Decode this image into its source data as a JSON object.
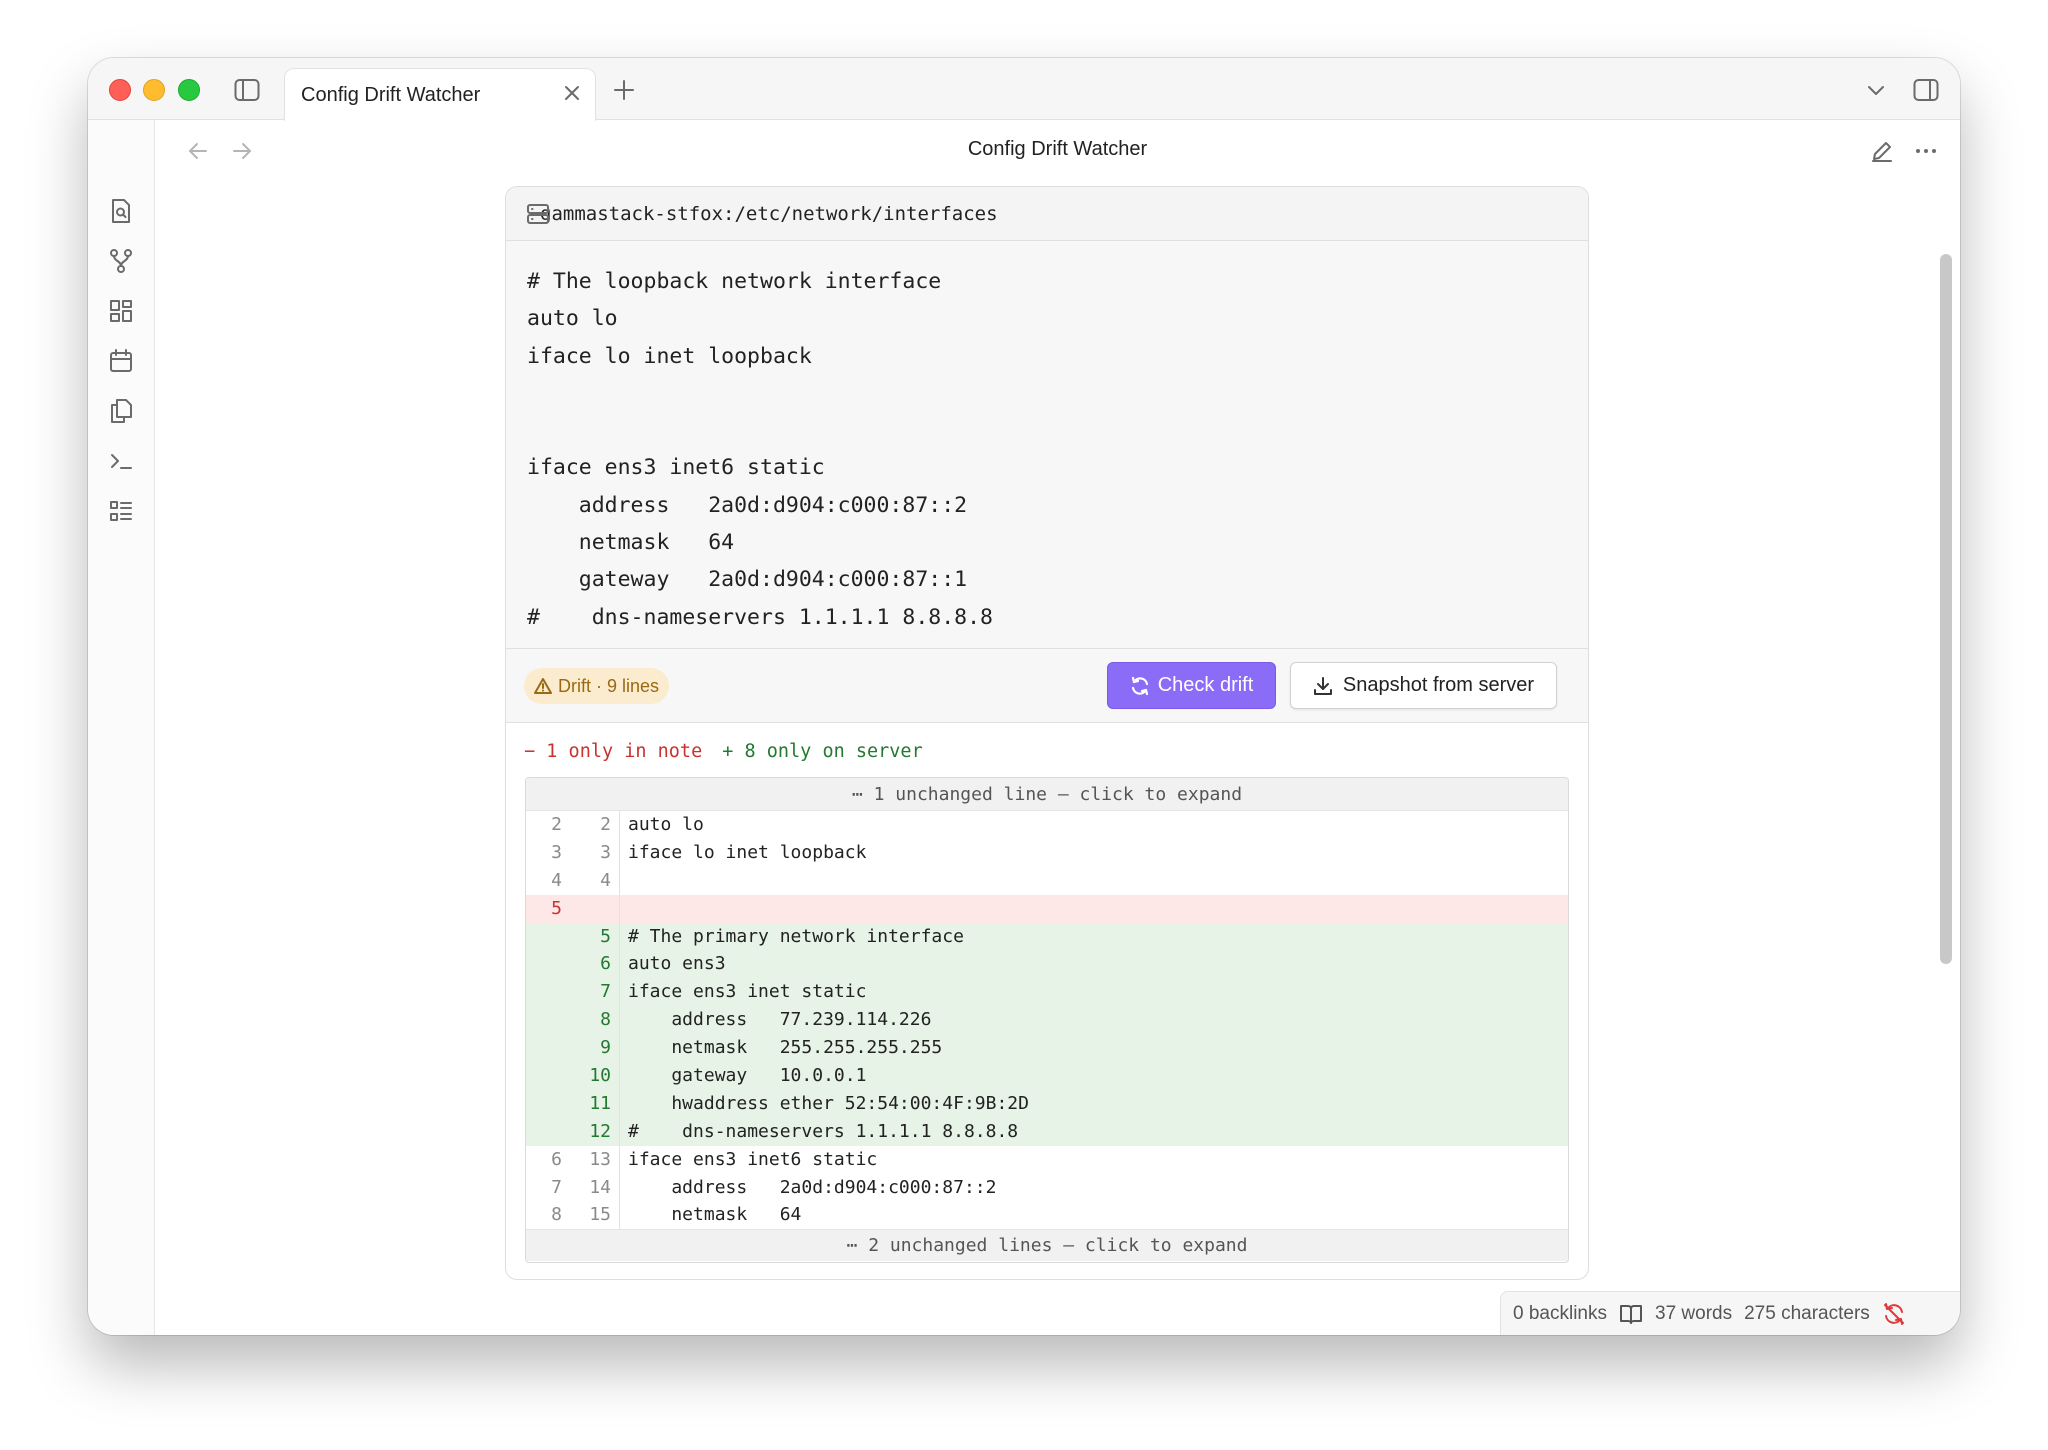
{
  "window": {
    "tab_title": "Config Drift Watcher",
    "view_title": "Config Drift Watcher"
  },
  "block": {
    "path": "gammastack-stfox:/etc/network/interfaces",
    "code_lines": [
      "# The loopback network interface",
      "auto lo",
      "iface lo inet loopback",
      "",
      "",
      "iface ens3 inet6 static",
      "    address   2a0d:d904:c000:87::2",
      "    netmask   64",
      "    gateway   2a0d:d904:c000:87::1",
      "#    dns-nameservers 1.1.1.1 8.8.8.8"
    ],
    "drift_badge": "Drift · 9 lines",
    "check_button": "Check drift",
    "snapshot_button": "Snapshot from server",
    "summary_removed": "− 1 only in note",
    "summary_added": "+ 8 only on server"
  },
  "diff": {
    "fold_top": "⋯ 1 unchanged line — click to expand",
    "fold_bottom": "⋯ 2 unchanged lines — click to expand",
    "rows": [
      {
        "type": "context",
        "old": "2",
        "new": "2",
        "text": "auto lo"
      },
      {
        "type": "context",
        "old": "3",
        "new": "3",
        "text": "iface lo inet loopback"
      },
      {
        "type": "context",
        "old": "4",
        "new": "4",
        "text": ""
      },
      {
        "type": "removed",
        "old": "5",
        "new": "",
        "text": ""
      },
      {
        "type": "added",
        "old": "",
        "new": "5",
        "text": "# The primary network interface"
      },
      {
        "type": "added",
        "old": "",
        "new": "6",
        "text": "auto ens3"
      },
      {
        "type": "added",
        "old": "",
        "new": "7",
        "text": "iface ens3 inet static"
      },
      {
        "type": "added",
        "old": "",
        "new": "8",
        "text": "    address   77.239.114.226"
      },
      {
        "type": "added",
        "old": "",
        "new": "9",
        "text": "    netmask   255.255.255.255"
      },
      {
        "type": "added",
        "old": "",
        "new": "10",
        "text": "    gateway   10.0.0.1"
      },
      {
        "type": "added",
        "old": "",
        "new": "11",
        "text": "    hwaddress ether 52:54:00:4F:9B:2D"
      },
      {
        "type": "added",
        "old": "",
        "new": "12",
        "text": "#    dns-nameservers 1.1.1.1 8.8.8.8"
      },
      {
        "type": "context",
        "old": "6",
        "new": "13",
        "text": "iface ens3 inet6 static"
      },
      {
        "type": "context",
        "old": "7",
        "new": "14",
        "text": "    address   2a0d:d904:c000:87::2"
      },
      {
        "type": "context",
        "old": "8",
        "new": "15",
        "text": "    netmask   64"
      }
    ]
  },
  "status": {
    "backlinks": "0 backlinks",
    "words": "37 words",
    "characters": "275 characters"
  },
  "colors": {
    "accent": "#8b6cf6",
    "removed": "#c8332e",
    "added": "#22792f",
    "drift": "#9a6a12"
  },
  "icons": [
    "sidebar-toggle-icon",
    "close-icon",
    "plus-icon",
    "chevron-down-icon",
    "right-sidebar-icon",
    "file-search-icon",
    "git-branch-icon",
    "grid-icon",
    "calendar-icon",
    "copy-icon",
    "terminal-icon",
    "list-icon",
    "back-arrow-icon",
    "forward-arrow-icon",
    "edit-icon",
    "more-icon",
    "server-icon",
    "warning-icon",
    "refresh-icon",
    "download-icon",
    "book-icon",
    "sync-off-icon"
  ]
}
